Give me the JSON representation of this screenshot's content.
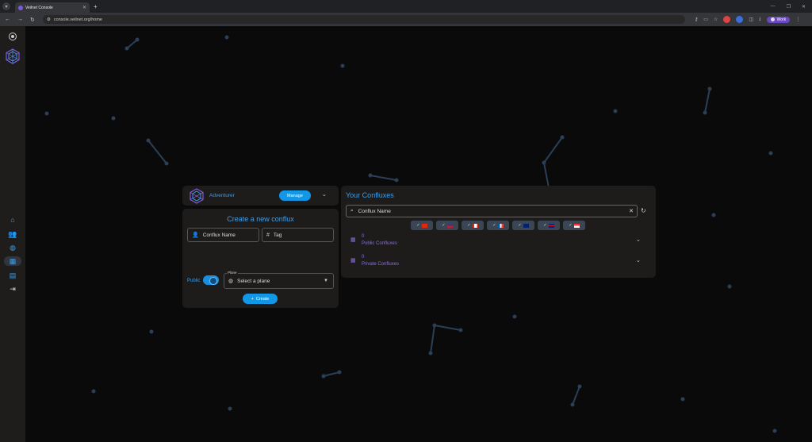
{
  "browser": {
    "tab_title": "Veilnet Console",
    "url": "console.veilnet.org/home",
    "profile_label": "Work"
  },
  "colors": {
    "accent": "#1296e6",
    "accent_text": "#3d9eea",
    "purple": "#8a6ee0",
    "panel": "#1e1c1b"
  },
  "sidebar": {
    "items": [
      {
        "icon": "home-icon"
      },
      {
        "icon": "people-icon"
      },
      {
        "icon": "globe-icon"
      },
      {
        "icon": "confluxes-icon",
        "active": true
      },
      {
        "icon": "server-icon"
      },
      {
        "icon": "logout-icon"
      }
    ]
  },
  "profile": {
    "name": "Adventurer",
    "manage_label": "Manage"
  },
  "create": {
    "title": "Create a new conflux",
    "name_placeholder": "Conflux Name",
    "tag_placeholder": "Tag",
    "public_label": "Public",
    "plane_legend": "Plane",
    "plane_placeholder": "Select a plane",
    "create_label": "Create"
  },
  "confluxes": {
    "title": "Your Confluxes",
    "search_placeholder": "Conflux Name",
    "regions": [
      {
        "code": "cn",
        "icon": "check-icon"
      },
      {
        "code": "us",
        "icon": "check-icon"
      },
      {
        "code": "ca",
        "icon": "check-icon"
      },
      {
        "code": "fr",
        "icon": "check-icon"
      },
      {
        "code": "au",
        "icon": "check-icon"
      },
      {
        "code": "gb",
        "icon": "check-icon"
      },
      {
        "code": "sg",
        "icon": "check-icon"
      }
    ],
    "groups": [
      {
        "count": "0",
        "label": "Public Confluxes"
      },
      {
        "count": "0",
        "label": "Private Confluxes"
      }
    ]
  }
}
